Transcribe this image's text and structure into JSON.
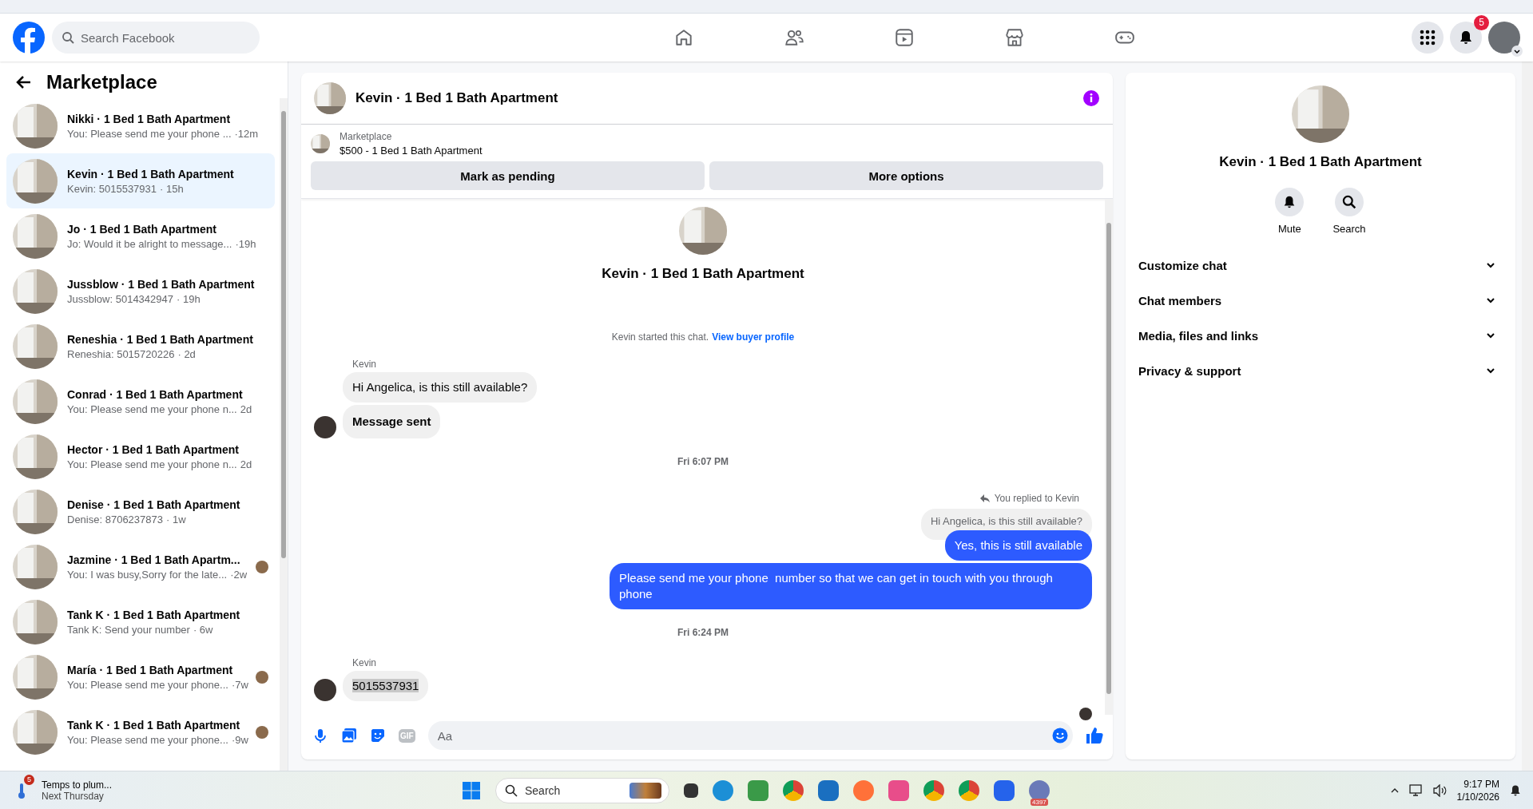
{
  "header": {
    "search_placeholder": "Search Facebook",
    "notification_count": "5"
  },
  "sidebar": {
    "title": "Marketplace",
    "conversations": [
      {
        "name": "Nikki · 1 Bed 1 Bath Apartment",
        "preview": "You: Please send me your phone ...",
        "time": "·12m",
        "selected": false,
        "seen_avatar": false
      },
      {
        "name": "Kevin · 1 Bed 1 Bath Apartment",
        "preview": "Kevin: 5015537931",
        "time": "· 15h",
        "selected": true,
        "seen_avatar": false
      },
      {
        "name": "Jo · 1 Bed 1 Bath Apartment",
        "preview": "Jo: Would it be alright to message...",
        "time": "·19h",
        "selected": false,
        "seen_avatar": false
      },
      {
        "name": "Jussblow · 1 Bed 1 Bath Apartment",
        "preview": "Jussblow: 5014342947",
        "time": "· 19h",
        "selected": false,
        "seen_avatar": false
      },
      {
        "name": "Reneshia · 1 Bed 1 Bath Apartment",
        "preview": "Reneshia: 5015720226",
        "time": "· 2d",
        "selected": false,
        "seen_avatar": false
      },
      {
        "name": "Conrad · 1 Bed 1 Bath Apartment",
        "preview": "You: Please send me your phone n...",
        "time": "2d",
        "selected": false,
        "seen_avatar": false
      },
      {
        "name": "Hector · 1 Bed 1 Bath Apartment",
        "preview": "You: Please send me your phone n...",
        "time": "2d",
        "selected": false,
        "seen_avatar": false
      },
      {
        "name": "Denise · 1 Bed 1 Bath Apartment",
        "preview": "Denise: 8706237873",
        "time": "· 1w",
        "selected": false,
        "seen_avatar": false
      },
      {
        "name": "Jazmine · 1 Bed 1 Bath Apartm...",
        "preview": "You: I was busy,Sorry for the late...",
        "time": "·2w",
        "selected": false,
        "seen_avatar": true
      },
      {
        "name": "Tank K · 1 Bed 1 Bath Apartment",
        "preview": "Tank K: Send your number",
        "time": "· 6w",
        "selected": false,
        "seen_avatar": false
      },
      {
        "name": "María · 1 Bed 1 Bath Apartment",
        "preview": "You: Please send me your phone...",
        "time": "·7w",
        "selected": false,
        "seen_avatar": true
      },
      {
        "name": "Tank K · 1 Bed 1 Bath Apartment",
        "preview": "You: Please send me your phone...",
        "time": "·9w",
        "selected": false,
        "seen_avatar": true
      }
    ]
  },
  "chat": {
    "title": "Kevin · 1 Bed 1 Bath Apartment",
    "listing": {
      "label": "Marketplace",
      "title": "$500 - 1 Bed 1 Bath Apartment"
    },
    "actions": [
      "Mark as pending",
      "More options"
    ],
    "intro_name": "Kevin · 1 Bed 1 Bath Apartment",
    "started": {
      "text": "Kevin started this chat.",
      "link": "View buyer profile"
    },
    "messages": [
      {
        "kind": "sender",
        "text": "Kevin"
      },
      {
        "kind": "incoming",
        "text": "Hi Angelica, is this still available?",
        "bold": false,
        "highlighted": false,
        "avatar": false
      },
      {
        "kind": "incoming",
        "text": "Message sent",
        "bold": true,
        "highlighted": false,
        "avatar": true
      },
      {
        "kind": "timestamp",
        "text": "Fri 6:07 PM"
      },
      {
        "kind": "reply_note",
        "text": "You replied to Kevin"
      },
      {
        "kind": "quoted",
        "text": "Hi Angelica, is this still available?"
      },
      {
        "kind": "outgoing",
        "text": "Yes, this is still available"
      },
      {
        "kind": "outgoing",
        "text": "Please send me your phone  number so that we can get in touch with you through phone"
      },
      {
        "kind": "timestamp",
        "text": "Fri 6:24 PM"
      },
      {
        "kind": "sender",
        "text": "Kevin"
      },
      {
        "kind": "incoming",
        "text": "5015537931",
        "bold": false,
        "highlighted": true,
        "avatar": true
      }
    ],
    "composer": {
      "placeholder": "Aa",
      "gif_label": "GIF"
    }
  },
  "info_panel": {
    "title": "Kevin · 1 Bed 1 Bath Apartment",
    "actions": [
      {
        "kind": "mute",
        "label": "Mute"
      },
      {
        "kind": "search",
        "label": "Search"
      }
    ],
    "sections": [
      {
        "label": "Customize chat",
        "expanded": false
      },
      {
        "label": "Chat members",
        "expanded": false
      },
      {
        "label": "Media, files and links",
        "expanded": false
      },
      {
        "label": "Privacy & support",
        "expanded": false
      }
    ]
  },
  "taskbar": {
    "notification": {
      "count": "5",
      "title": "Temps to plum...",
      "subtitle": "Next Thursday"
    },
    "search_placeholder": "Search",
    "app_badge": "4397",
    "time": "9:17 PM",
    "date": "1/10/2026"
  }
}
